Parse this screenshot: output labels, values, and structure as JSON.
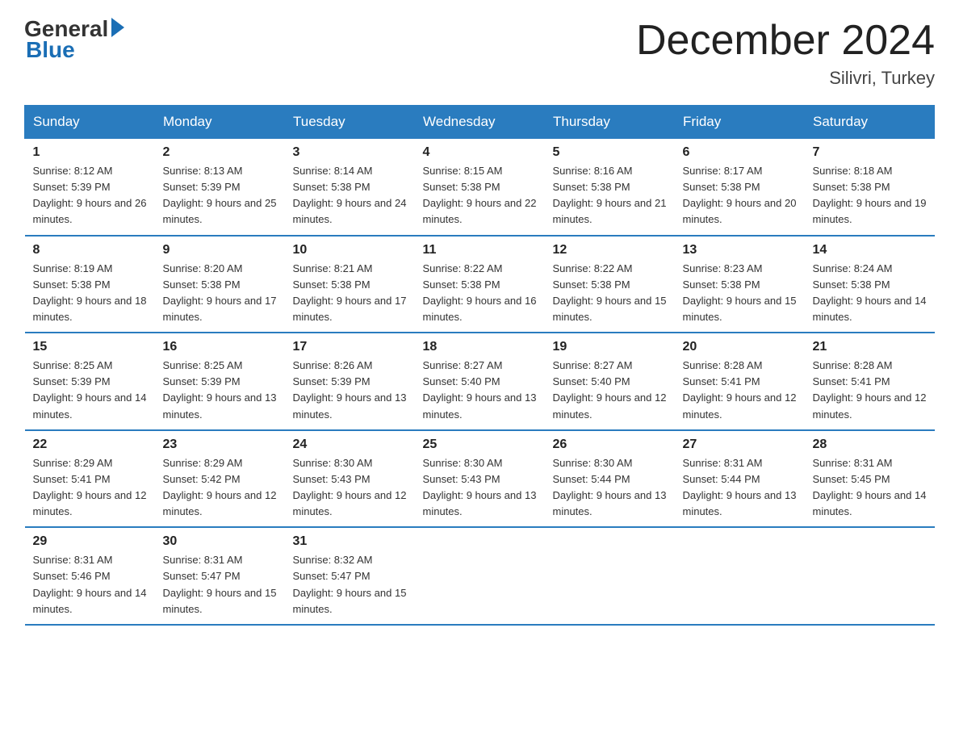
{
  "header": {
    "logo_general": "General",
    "logo_blue": "Blue",
    "title": "December 2024",
    "location": "Silivri, Turkey"
  },
  "days_of_week": [
    "Sunday",
    "Monday",
    "Tuesday",
    "Wednesday",
    "Thursday",
    "Friday",
    "Saturday"
  ],
  "weeks": [
    [
      {
        "day": "1",
        "sunrise": "8:12 AM",
        "sunset": "5:39 PM",
        "daylight": "9 hours and 26 minutes."
      },
      {
        "day": "2",
        "sunrise": "8:13 AM",
        "sunset": "5:39 PM",
        "daylight": "9 hours and 25 minutes."
      },
      {
        "day": "3",
        "sunrise": "8:14 AM",
        "sunset": "5:38 PM",
        "daylight": "9 hours and 24 minutes."
      },
      {
        "day": "4",
        "sunrise": "8:15 AM",
        "sunset": "5:38 PM",
        "daylight": "9 hours and 22 minutes."
      },
      {
        "day": "5",
        "sunrise": "8:16 AM",
        "sunset": "5:38 PM",
        "daylight": "9 hours and 21 minutes."
      },
      {
        "day": "6",
        "sunrise": "8:17 AM",
        "sunset": "5:38 PM",
        "daylight": "9 hours and 20 minutes."
      },
      {
        "day": "7",
        "sunrise": "8:18 AM",
        "sunset": "5:38 PM",
        "daylight": "9 hours and 19 minutes."
      }
    ],
    [
      {
        "day": "8",
        "sunrise": "8:19 AM",
        "sunset": "5:38 PM",
        "daylight": "9 hours and 18 minutes."
      },
      {
        "day": "9",
        "sunrise": "8:20 AM",
        "sunset": "5:38 PM",
        "daylight": "9 hours and 17 minutes."
      },
      {
        "day": "10",
        "sunrise": "8:21 AM",
        "sunset": "5:38 PM",
        "daylight": "9 hours and 17 minutes."
      },
      {
        "day": "11",
        "sunrise": "8:22 AM",
        "sunset": "5:38 PM",
        "daylight": "9 hours and 16 minutes."
      },
      {
        "day": "12",
        "sunrise": "8:22 AM",
        "sunset": "5:38 PM",
        "daylight": "9 hours and 15 minutes."
      },
      {
        "day": "13",
        "sunrise": "8:23 AM",
        "sunset": "5:38 PM",
        "daylight": "9 hours and 15 minutes."
      },
      {
        "day": "14",
        "sunrise": "8:24 AM",
        "sunset": "5:38 PM",
        "daylight": "9 hours and 14 minutes."
      }
    ],
    [
      {
        "day": "15",
        "sunrise": "8:25 AM",
        "sunset": "5:39 PM",
        "daylight": "9 hours and 14 minutes."
      },
      {
        "day": "16",
        "sunrise": "8:25 AM",
        "sunset": "5:39 PM",
        "daylight": "9 hours and 13 minutes."
      },
      {
        "day": "17",
        "sunrise": "8:26 AM",
        "sunset": "5:39 PM",
        "daylight": "9 hours and 13 minutes."
      },
      {
        "day": "18",
        "sunrise": "8:27 AM",
        "sunset": "5:40 PM",
        "daylight": "9 hours and 13 minutes."
      },
      {
        "day": "19",
        "sunrise": "8:27 AM",
        "sunset": "5:40 PM",
        "daylight": "9 hours and 12 minutes."
      },
      {
        "day": "20",
        "sunrise": "8:28 AM",
        "sunset": "5:41 PM",
        "daylight": "9 hours and 12 minutes."
      },
      {
        "day": "21",
        "sunrise": "8:28 AM",
        "sunset": "5:41 PM",
        "daylight": "9 hours and 12 minutes."
      }
    ],
    [
      {
        "day": "22",
        "sunrise": "8:29 AM",
        "sunset": "5:41 PM",
        "daylight": "9 hours and 12 minutes."
      },
      {
        "day": "23",
        "sunrise": "8:29 AM",
        "sunset": "5:42 PM",
        "daylight": "9 hours and 12 minutes."
      },
      {
        "day": "24",
        "sunrise": "8:30 AM",
        "sunset": "5:43 PM",
        "daylight": "9 hours and 12 minutes."
      },
      {
        "day": "25",
        "sunrise": "8:30 AM",
        "sunset": "5:43 PM",
        "daylight": "9 hours and 13 minutes."
      },
      {
        "day": "26",
        "sunrise": "8:30 AM",
        "sunset": "5:44 PM",
        "daylight": "9 hours and 13 minutes."
      },
      {
        "day": "27",
        "sunrise": "8:31 AM",
        "sunset": "5:44 PM",
        "daylight": "9 hours and 13 minutes."
      },
      {
        "day": "28",
        "sunrise": "8:31 AM",
        "sunset": "5:45 PM",
        "daylight": "9 hours and 14 minutes."
      }
    ],
    [
      {
        "day": "29",
        "sunrise": "8:31 AM",
        "sunset": "5:46 PM",
        "daylight": "9 hours and 14 minutes."
      },
      {
        "day": "30",
        "sunrise": "8:31 AM",
        "sunset": "5:47 PM",
        "daylight": "9 hours and 15 minutes."
      },
      {
        "day": "31",
        "sunrise": "8:32 AM",
        "sunset": "5:47 PM",
        "daylight": "9 hours and 15 minutes."
      },
      null,
      null,
      null,
      null
    ]
  ]
}
